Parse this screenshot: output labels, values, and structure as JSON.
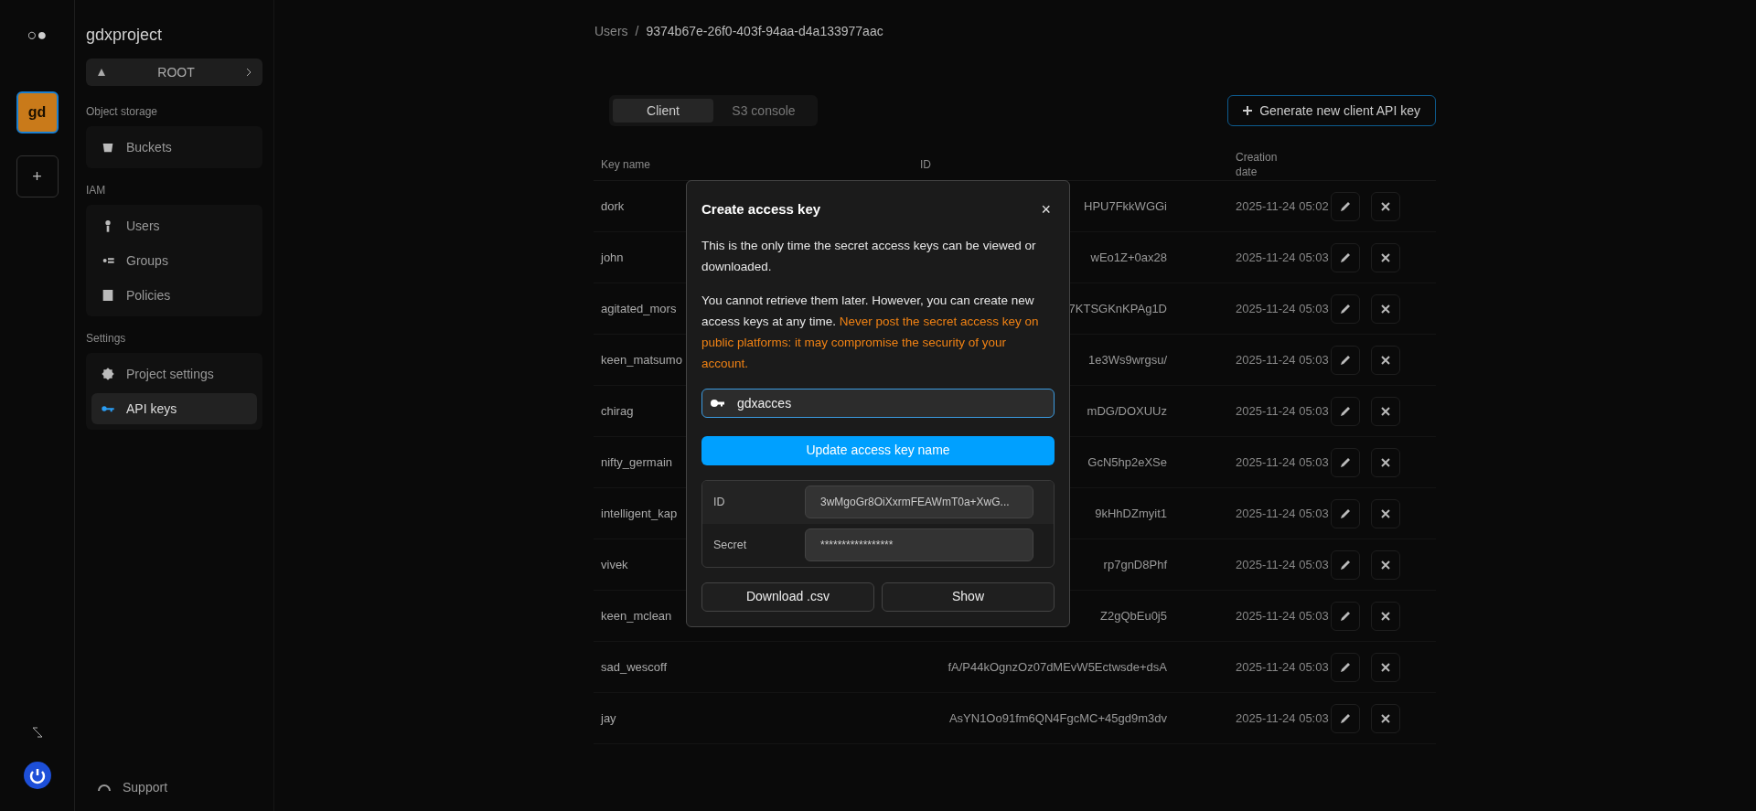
{
  "rail": {
    "logo": "○●",
    "project_avatar": "gd",
    "add_button": "+"
  },
  "sidebar": {
    "project": "gdxproject",
    "bucket_select": "ROOT",
    "sections": [
      {
        "title": "Object storage",
        "items": [
          {
            "label": "Buckets",
            "selected": false
          }
        ]
      },
      {
        "title": "IAM",
        "items": [
          {
            "label": "Users",
            "selected": false
          },
          {
            "label": "Groups",
            "selected": false
          },
          {
            "label": "Policies",
            "selected": false
          }
        ]
      },
      {
        "title": "Settings",
        "items": [
          {
            "label": "Project settings",
            "selected": false
          },
          {
            "label": "API keys",
            "selected": true
          }
        ]
      }
    ],
    "support": "Support"
  },
  "breadcrumb": [
    "Users",
    "/",
    "9374b67e-26f0-403f-94aa-d4a133977aac"
  ],
  "tabs": [
    {
      "label": "Client",
      "selected": true
    },
    {
      "label": "S3 console",
      "selected": false
    }
  ],
  "generate_button": "Generate new client API key",
  "table": {
    "columns": [
      "Key name",
      "ID",
      "Creation date"
    ],
    "rows": [
      {
        "name": "dork",
        "id": "HPU7FkkWGGi",
        "date": "2025-11-24 05:02"
      },
      {
        "name": "john",
        "id": "wEo1Z+0ax28",
        "date": "2025-11-24 05:03"
      },
      {
        "name": "agitated_mors",
        "id": "7KTSGKnKPAg1D",
        "date": "2025-11-24 05:03"
      },
      {
        "name": "keen_matsumo",
        "id": "1e3Ws9wrgsu/",
        "date": "2025-11-24 05:03"
      },
      {
        "name": "chirag",
        "id": "mDG/DOXUUz",
        "date": "2025-11-24 05:03"
      },
      {
        "name": "nifty_germain",
        "id": "GcN5hp2eXSe",
        "date": "2025-11-24 05:03"
      },
      {
        "name": "intelligent_kap",
        "id": "9kHhDZmyit1",
        "date": "2025-11-24 05:03"
      },
      {
        "name": "vivek",
        "id": "rp7gnD8Phf",
        "date": "2025-11-24 05:03"
      },
      {
        "name": "keen_mclean",
        "id": "Z2gQbEu0j5",
        "date": "2025-11-24 05:03"
      },
      {
        "name": "sad_wescoff",
        "id": "fA/P44kOgnzOz07dMEvW5Ectwsde+dsA",
        "date": "2025-11-24 05:03"
      },
      {
        "name": "jay",
        "id": "AsYN1Oo91fm6QN4FgcMC+45gd9m3dv",
        "date": "2025-11-24 05:03"
      }
    ]
  },
  "dialog": {
    "title": "Create access key",
    "close": "×",
    "notice": "This is the only time the secret access keys can be viewed or downloaded.",
    "notice_2": {
      "text": "You cannot retrieve them later. However, you can create new access keys at any time.",
      "warning": "Never post the secret access key on public platforms: it may compromise the security of your account."
    },
    "name_field": {
      "value": "gdxacces"
    },
    "update_button": "Update access key name",
    "credentials": [
      {
        "label": "ID",
        "value": "3wMgoGr8OiXxrmFEAWmT0a+XwG..."
      },
      {
        "label": "Secret",
        "value": "*****************"
      }
    ],
    "buttons": [
      "Download .csv",
      "Show"
    ]
  }
}
